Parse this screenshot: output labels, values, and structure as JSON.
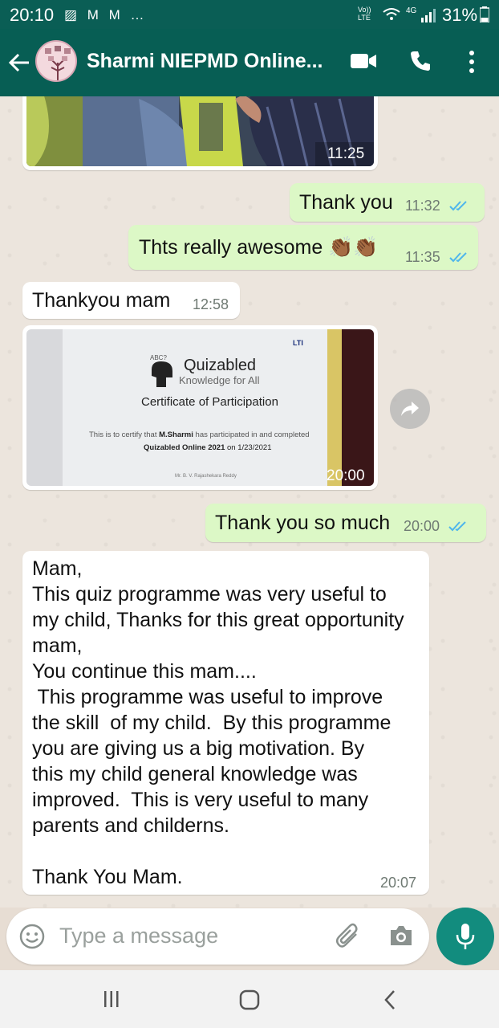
{
  "status_bar": {
    "time": "20:10",
    "notif_icons": "▨ M M …",
    "network_label": "Vo)) LTE",
    "signal_label": "4G",
    "battery": "31%"
  },
  "app_bar": {
    "title": "Sharmi NIEPMD Online...",
    "icons": [
      "back-arrow-icon",
      "video-call-icon",
      "phone-icon",
      "more-vert-icon"
    ]
  },
  "messages": [
    {
      "type": "image",
      "direction": "in",
      "time": "11:25"
    },
    {
      "type": "text",
      "direction": "out",
      "text": "Thank you",
      "time": "11:32",
      "status": "read"
    },
    {
      "type": "text",
      "direction": "out",
      "text": "Thts really awesome 👏🏾👏🏾",
      "time": "11:35",
      "status": "read"
    },
    {
      "type": "text",
      "direction": "in",
      "text": "Thankyou mam",
      "time": "12:58"
    },
    {
      "type": "image",
      "direction": "in",
      "time": "20:00",
      "image_text": {
        "brand": "LTI",
        "logo_title": "Quizabled",
        "logo_subtitle": "Knowledge for All",
        "heading": "Certificate of Participation",
        "line1_prefix": "This is to certify that ",
        "line1_name": "M.Sharmi",
        "line1_suffix": " has participated in and completed",
        "line2_event": "Quizabled Online 2021",
        "line2_date": " on 1/23/2021",
        "signer": "Mr. B. V. Rajashekara Reddy"
      }
    },
    {
      "type": "text",
      "direction": "out",
      "text": "Thank you so much",
      "time": "20:00",
      "status": "read"
    },
    {
      "type": "text",
      "direction": "in",
      "text": "Mam,\nThis quiz programme was very useful to\nmy child, Thanks for this great opportunity\nmam,\nYou continue this mam....\n This programme was useful to improve\nthe skill  of my child.  By this programme\nyou are giving us a big motivation. By\nthis my child general knowledge was\nimproved.  This is very useful to many\nparents and childerns.\n\nThank You Mam.",
      "time": "20:07"
    }
  ],
  "input": {
    "placeholder": "Type a message"
  },
  "colors": {
    "header": "#075e54",
    "outgoing_bubble": "#dcf8c6",
    "incoming_bubble": "#ffffff",
    "accent": "#128c7e",
    "read_tick": "#4fb6ec"
  }
}
